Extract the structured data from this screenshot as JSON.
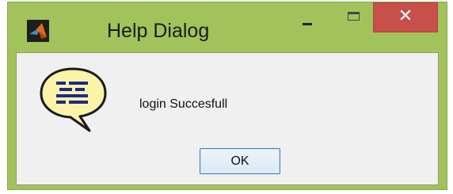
{
  "window": {
    "title": "Help Dialog",
    "close_glyph": "✕",
    "colors": {
      "frame": "#a2c35b",
      "close_button": "#c7504b",
      "client_background": "#f0f0f0"
    }
  },
  "dialog": {
    "icon": "help-speech-bubble-icon",
    "message": "login Succesfull",
    "ok_label": "OK"
  }
}
